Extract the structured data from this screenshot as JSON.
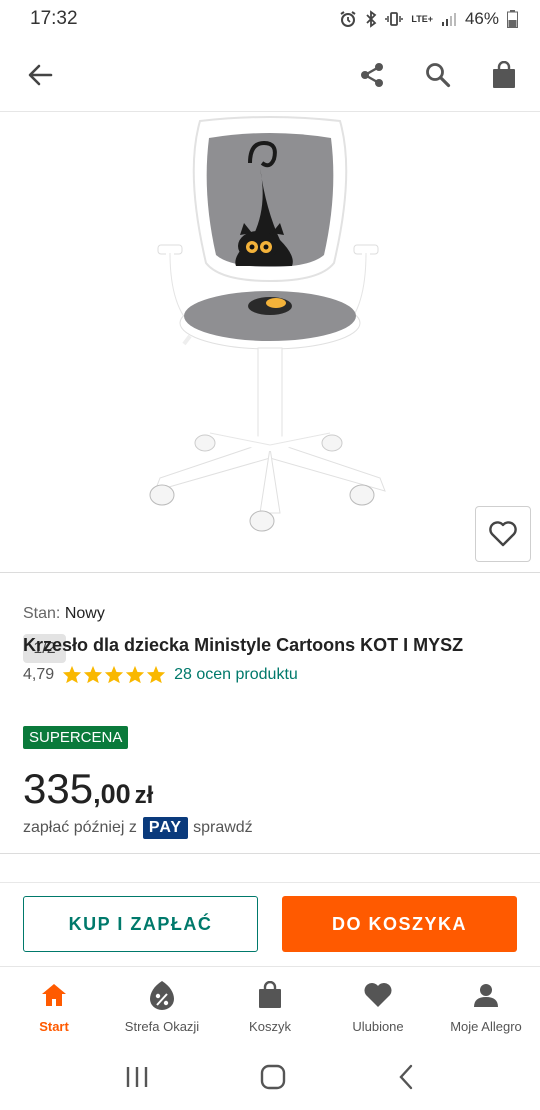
{
  "status_bar": {
    "time": "17:32",
    "battery": "46%",
    "network_label": "LTE+"
  },
  "app_bar": {
    "icons": [
      "back-arrow-icon",
      "share-icon",
      "search-icon",
      "shopping-bag-icon"
    ]
  },
  "gallery": {
    "page_indicator": "1/2"
  },
  "product": {
    "condition_label": "Stan:",
    "condition_value": "Nowy",
    "title": "Krzesło dla dziecka Ministyle Cartoons KOT I MYSZ",
    "rating_value": "4,79",
    "rating_stars": 5,
    "rating_count_text": "28 ocen produktu",
    "badge": "SUPERCENA",
    "price_main": "335",
    "price_decimal": ",00",
    "price_currency": "zł",
    "pay_later_prefix": "zapłać później z",
    "pay_later_brand": "PAY",
    "pay_later_link": "sprawdź"
  },
  "actions": {
    "buy_now": "KUP I ZAPŁAĆ",
    "add_to_cart": "DO KOSZYKA"
  },
  "bottom_nav": {
    "items": [
      {
        "label": "Start",
        "icon": "home-icon",
        "active": true
      },
      {
        "label": "Strefa Okazji",
        "icon": "percent-tag-icon",
        "active": false
      },
      {
        "label": "Koszyk",
        "icon": "cart-bag-icon",
        "active": false
      },
      {
        "label": "Ulubione",
        "icon": "heart-icon",
        "active": false
      },
      {
        "label": "Moje Allegro",
        "icon": "user-icon",
        "active": false
      }
    ]
  },
  "colors": {
    "accent_orange": "#ff5a00",
    "accent_teal": "#00796b",
    "badge_green": "#0a7a3b",
    "pay_blue": "#0a3a7c",
    "star_yellow": "#f9b800"
  }
}
